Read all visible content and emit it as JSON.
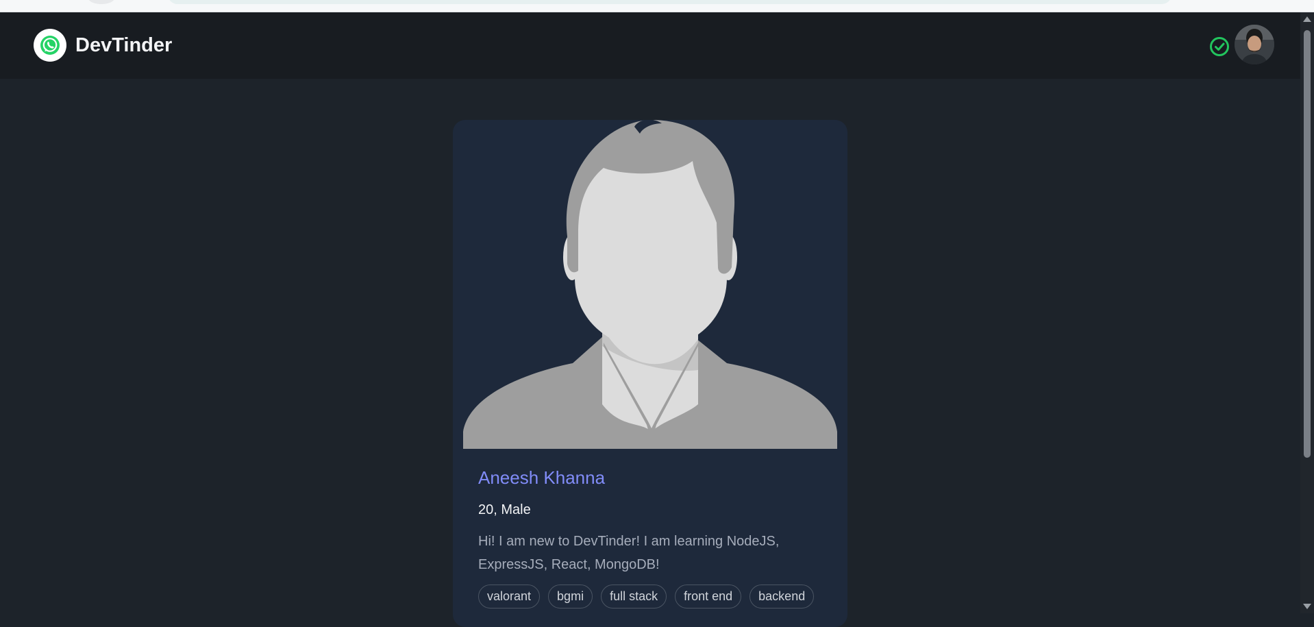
{
  "header": {
    "brand_name": "DevTinder"
  },
  "profile": {
    "name": "Aneesh Khanna",
    "age_gender": "20, Male",
    "about": "Hi! I am new to DevTinder! I am learning NodeJS, ExpressJS, React, MongoDB!",
    "skills": [
      "valorant",
      "bgmi",
      "full stack",
      "front end",
      "backend"
    ]
  },
  "colors": {
    "accent": "#818cf8",
    "verified": "#22c55e",
    "background": "#1d232a",
    "card": "#1e293b"
  },
  "icons": {
    "brand": "whatsapp-icon",
    "status": "check-circle-icon"
  }
}
